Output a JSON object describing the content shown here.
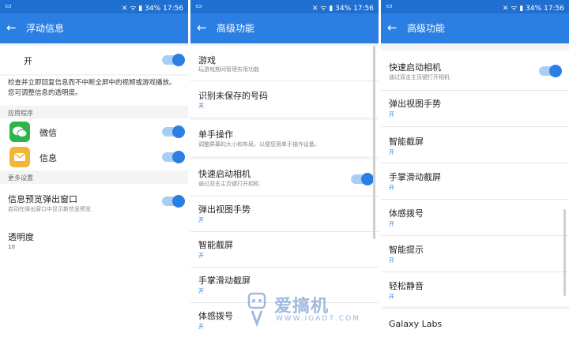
{
  "status": {
    "time": "17:56",
    "battery": "34%",
    "signal": "✕ ᯤ ▮"
  },
  "panel1": {
    "title": "浮动信息",
    "master_label": "开",
    "description": "检查并立即回复信息而不中断全屏中的视频或游戏播放。您可调整信息的透明度。",
    "section_apps": "应用程序",
    "apps": [
      {
        "label": "微信"
      },
      {
        "label": "信息"
      }
    ],
    "section_more": "更多设置",
    "preview_title": "信息预览弹出窗口",
    "preview_sub": "启动在弹出窗口中显示新信息预览",
    "opacity_title": "透明度",
    "opacity_value": "10"
  },
  "panel2": {
    "title": "高级功能",
    "items": [
      {
        "title": "游戏",
        "sub": "玩游戏期间管理实用功能",
        "value": ""
      },
      {
        "title": "识别未保存的号码",
        "sub": "",
        "value": "关"
      },
      {
        "title": "单手操作",
        "sub": "调整屏幕的大小和布局，以便您用单手操作设备。",
        "value": ""
      },
      {
        "title": "快速启动相机",
        "sub": "通过双击主页键打开相机",
        "value": ""
      },
      {
        "title": "弹出视图手势",
        "sub": "",
        "value": "开"
      },
      {
        "title": "智能截屏",
        "sub": "",
        "value": "开"
      },
      {
        "title": "手掌滑动截屏",
        "sub": "",
        "value": "开"
      },
      {
        "title": "体感拨号",
        "sub": "",
        "value": "开"
      }
    ]
  },
  "panel3": {
    "title": "高级功能",
    "items": [
      {
        "title": "快速启动相机",
        "sub": "通过双击主页键打开相机",
        "value": ""
      },
      {
        "title": "弹出视图手势",
        "sub": "",
        "value": "开"
      },
      {
        "title": "智能截屏",
        "sub": "",
        "value": "开"
      },
      {
        "title": "手掌滑动截屏",
        "sub": "",
        "value": "开"
      },
      {
        "title": "体感拨号",
        "sub": "",
        "value": "开"
      },
      {
        "title": "智能提示",
        "sub": "",
        "value": "开"
      },
      {
        "title": "轻松静音",
        "sub": "",
        "value": "开"
      },
      {
        "title": "Galaxy Labs",
        "sub": "",
        "value": ""
      }
    ]
  },
  "watermark": {
    "name": "爱搞机",
    "url": "WWW.IGAO7.COM"
  },
  "colors": {
    "accent": "#2c7fe2",
    "statusbar": "#1f6fd1",
    "toggle_track": "#a9cdf3"
  }
}
